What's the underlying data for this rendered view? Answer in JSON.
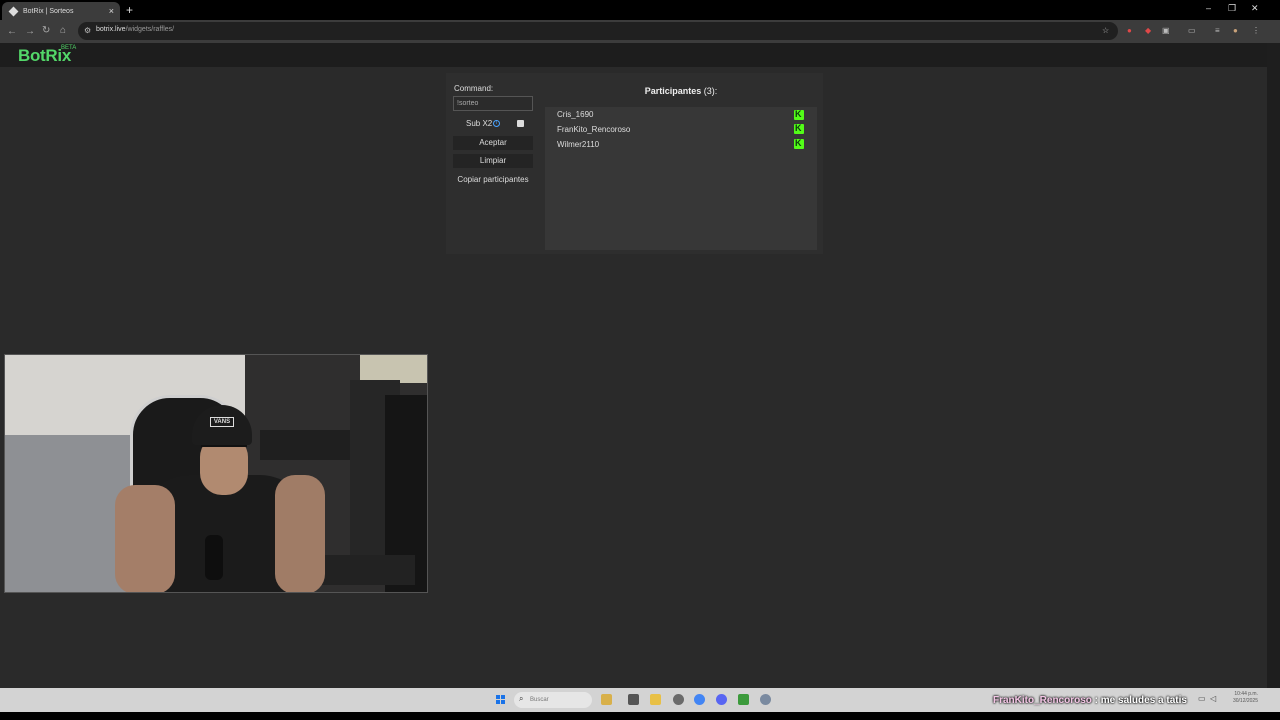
{
  "browser": {
    "tab_title": "BotRix | Sorteos",
    "tab_close": "×",
    "new_tab": "+",
    "url_host": "botrix.live",
    "url_path": "/widgets/raffles/",
    "window_minimize": "–",
    "window_restore": "❐",
    "window_close": "✕",
    "nav_back": "←",
    "nav_forward": "→",
    "nav_reload": "↻",
    "nav_home": "⌂"
  },
  "app": {
    "logo": "BotRix",
    "beta": "BETA"
  },
  "raffle": {
    "command_label": "Command:",
    "command_value": "!sorteo",
    "sub_x2_label": "Sub X2",
    "info_glyph": "i",
    "accept_label": "Aceptar",
    "clear_label": "Limpiar",
    "copy_label": "Copiar participantes",
    "participants_title": "Participantes",
    "participants_count": "(3):",
    "participants": [
      {
        "name": "Cris_1690"
      },
      {
        "name": "FranKito_Rencoroso"
      },
      {
        "name": "Wilmer2110"
      }
    ],
    "kick_glyph": "K"
  },
  "webcam": {
    "cap_text": "VANS"
  },
  "taskbar": {
    "search_placeholder": "Buscar",
    "search_glyph": "⌕"
  },
  "chat_overlay": {
    "user": "FranKito_Rencoroso",
    "message": " : me saludes a tatis"
  },
  "clock": {
    "time": "10:44 p.m.",
    "date": "30/12/2025"
  },
  "colors": {
    "brand": "#53d769",
    "kick": "#53fc18"
  }
}
